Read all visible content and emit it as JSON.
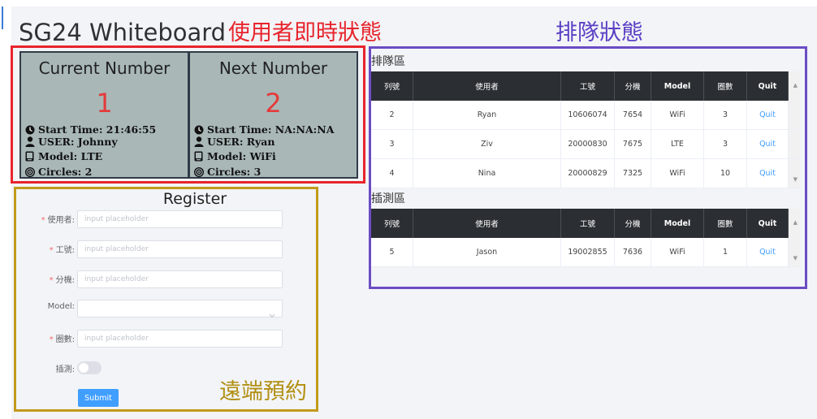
{
  "app": {
    "title": "SG24 Whiteboard"
  },
  "annotations": {
    "live_status": "使用者即時狀態",
    "queue_status": "排隊狀態",
    "remote_booking": "遠端預約"
  },
  "status": {
    "current": {
      "title": "Current Number",
      "number": "1",
      "start_time": "Start Time: 21:46:55",
      "user": "USER: Johnny",
      "model": "Model: LTE",
      "circles": "Circles: 2"
    },
    "next": {
      "title": "Next Number",
      "number": "2",
      "start_time": "Start Time: NA:NA:NA",
      "user": "USER: Ryan",
      "model": "Model: WiFi",
      "circles": "Circles: 3"
    }
  },
  "register": {
    "title": "Register",
    "fields": {
      "user": {
        "label": "使用者:",
        "placeholder": "input placeholder"
      },
      "employee_id": {
        "label": "工號:",
        "placeholder": "input placeholder"
      },
      "extension": {
        "label": "分機:",
        "placeholder": "input placeholder"
      },
      "model": {
        "label": "Model:"
      },
      "laps": {
        "label": "圈數:",
        "placeholder": "input placeholder"
      },
      "cut_in": {
        "label": "插測:"
      }
    },
    "submit_label": "Submit"
  },
  "tables": {
    "columns": [
      "列號",
      "使用者",
      "工號",
      "分機",
      "Model",
      "圈數",
      "Quit"
    ],
    "queue": {
      "title": "排隊區",
      "rows": [
        {
          "no": "2",
          "user": "Ryan",
          "employee_id": "10606074",
          "ext": "7654",
          "model": "WiFi",
          "laps": "3",
          "action": "Quit"
        },
        {
          "no": "3",
          "user": "Ziv",
          "employee_id": "20000830",
          "ext": "7675",
          "model": "LTE",
          "laps": "3",
          "action": "Quit"
        },
        {
          "no": "4",
          "user": "Nina",
          "employee_id": "20000829",
          "ext": "7325",
          "model": "WiFi",
          "laps": "10",
          "action": "Quit"
        }
      ]
    },
    "cutin": {
      "title": "插測區",
      "rows": [
        {
          "no": "5",
          "user": "Jason",
          "employee_id": "19002855",
          "ext": "7636",
          "model": "WiFi",
          "laps": "1",
          "action": "Quit"
        }
      ]
    }
  },
  "colors": {
    "primary": "#409eff",
    "header_dark": "#2b2f33",
    "status_bg": "#a9b7b7",
    "number_red": "#e43a3a",
    "annotation_red": "#e8242c",
    "annotation_purple": "#5b3fc4",
    "annotation_gold": "#b28f12"
  },
  "icons": [
    "clock-icon",
    "user-icon",
    "device-icon",
    "target-icon",
    "chevron-down-icon"
  ]
}
